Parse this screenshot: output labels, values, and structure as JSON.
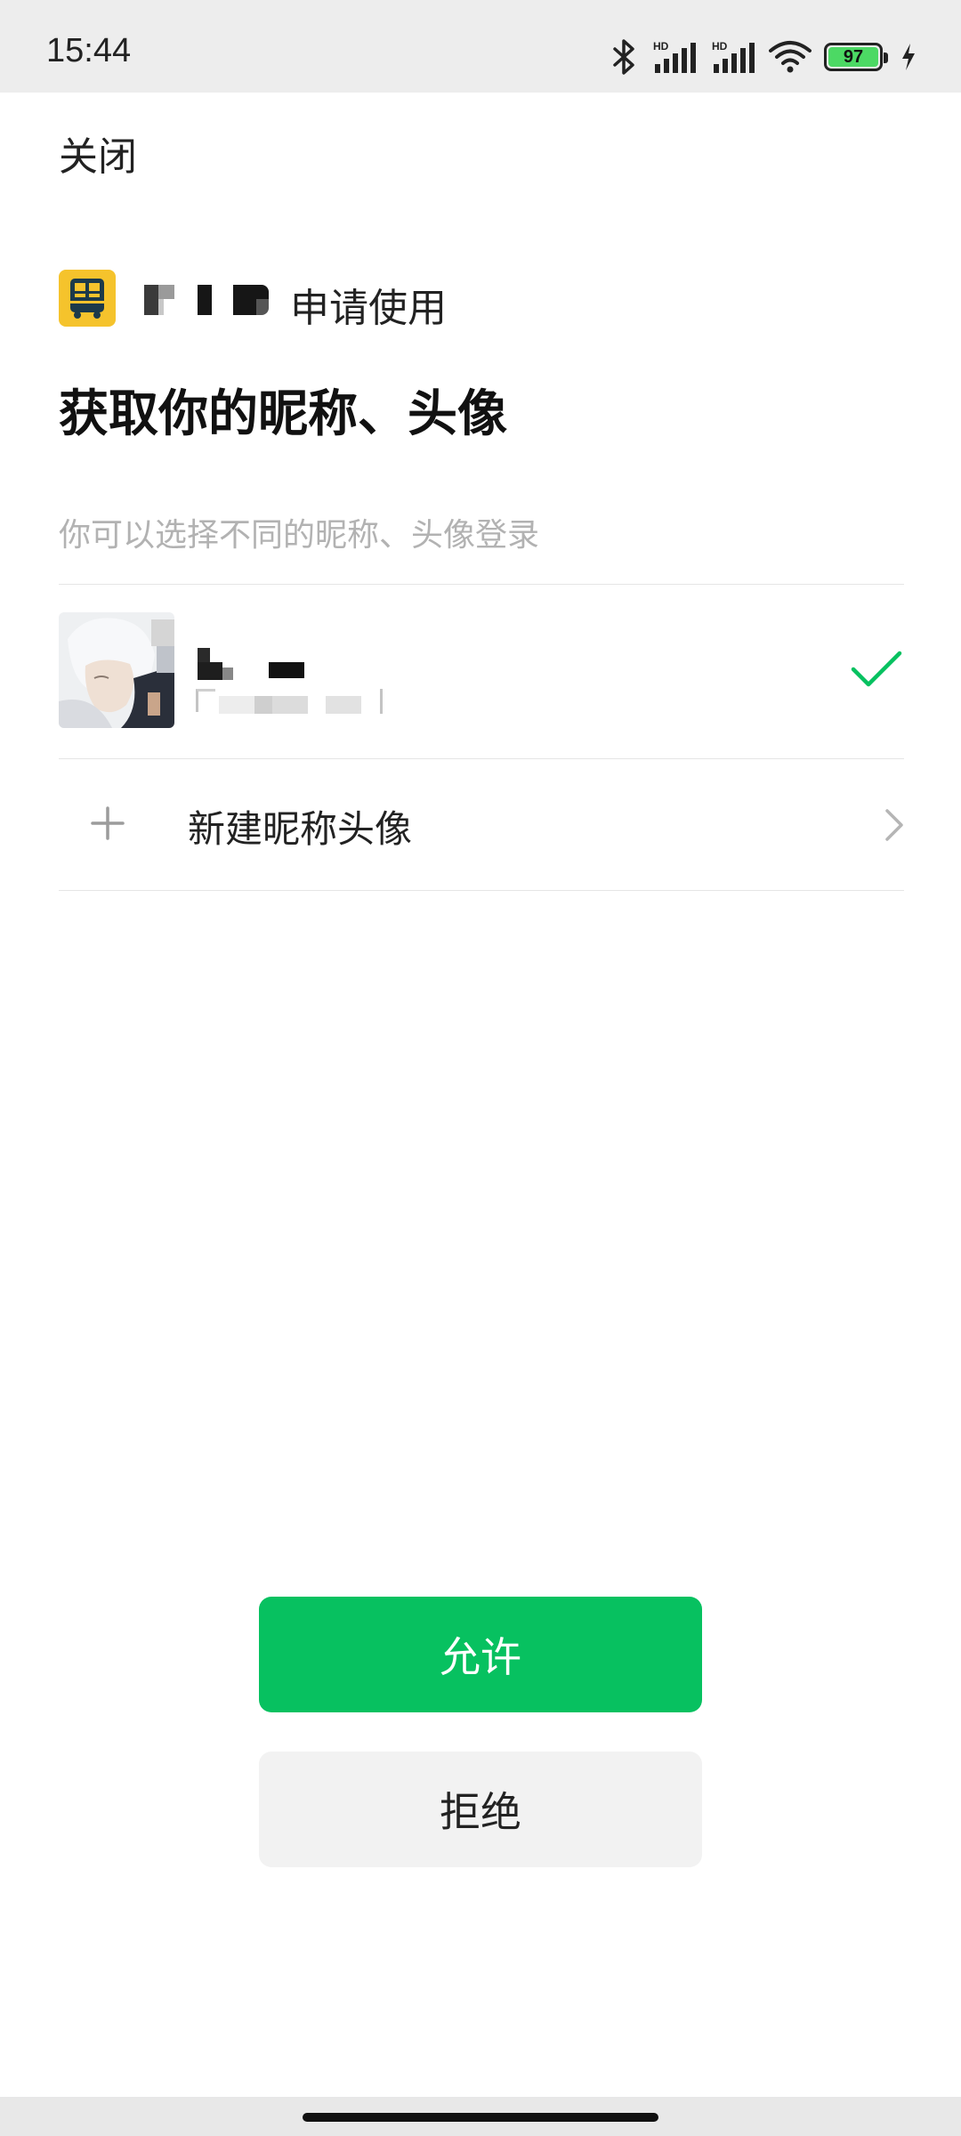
{
  "status_bar": {
    "time": "15:44",
    "battery_level": "97",
    "icons": [
      "bluetooth-icon",
      "hd-signal-icon",
      "hd-signal-icon",
      "wifi-icon",
      "battery-icon",
      "charging-icon"
    ],
    "hd_label": "HD"
  },
  "header": {
    "close_label": "关闭"
  },
  "app": {
    "logo_icon": "bus-icon",
    "logo_color": "#f5c32c",
    "request_text": "申请使用"
  },
  "title": "获取你的昵称、头像",
  "hint": "你可以选择不同的昵称、头像登录",
  "accounts": [
    {
      "selected": true,
      "selected_icon": "check-icon",
      "accent": "#07c160"
    }
  ],
  "new_profile": {
    "label": "新建昵称头像",
    "plus_icon": "plus-icon",
    "chevron_icon": "chevron-right-icon"
  },
  "actions": {
    "allow_label": "允许",
    "deny_label": "拒绝",
    "allow_color": "#07c160"
  }
}
